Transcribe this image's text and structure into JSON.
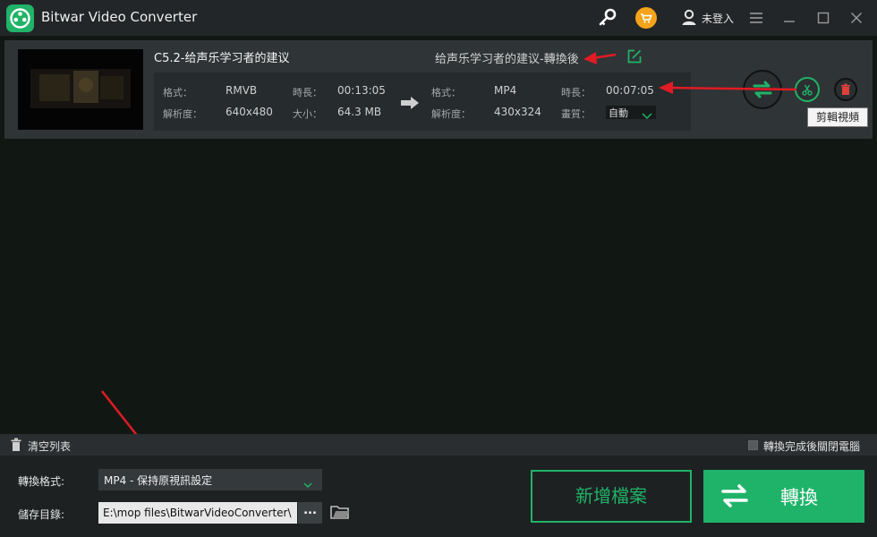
{
  "app": {
    "title": "Bitwar Video Converter",
    "login_label": "未登入",
    "accent": "#21b368",
    "cart_color": "#f5a31a"
  },
  "icons": [
    "key-icon",
    "cart-icon",
    "user-icon",
    "menu-icon",
    "minimize-icon",
    "maximize-icon",
    "close-icon",
    "edit-icon",
    "arrow-right-icon",
    "convert-icon",
    "scissors-icon",
    "trash-icon",
    "folder-icon",
    "chevron-down-icon"
  ],
  "file": {
    "name": "C5.2-给声乐学习者的建议",
    "output_name": "给声乐学习者的建议-轉換後",
    "source": {
      "format_label": "格式：",
      "format": "RMVB",
      "duration_label": "時長：",
      "duration": "00:13:05",
      "resolution_label": "解析度：",
      "resolution": "640x480",
      "size_label": "大小：",
      "size": "64.3 MB"
    },
    "target": {
      "format_label": "格式：",
      "format": "MP4",
      "duration_label": "時長：",
      "duration": "00:07:05",
      "resolution_label": "解析度：",
      "resolution": "430x324",
      "quality_label": "畫質：",
      "quality": "自動"
    }
  },
  "tooltip": "剪輯視頻",
  "toolbar": {
    "clear_label": "清空列表",
    "shutdown_label": "轉換完成後關閉電腦"
  },
  "bottom": {
    "format_label": "轉換格式:",
    "format_value": "MP4 - 保持原視訊設定",
    "save_label": "儲存目錄:",
    "save_path": "E:\\mop files\\BitwarVideoConverter\\",
    "browse_label": "...",
    "add_file_label": "新增檔案",
    "convert_label": "轉換"
  }
}
